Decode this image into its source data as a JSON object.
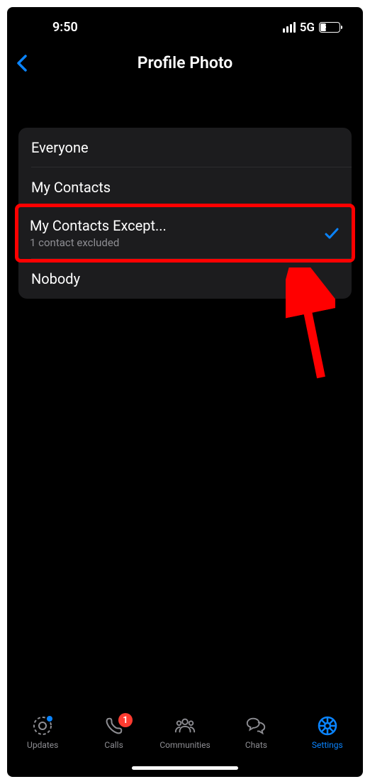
{
  "statusBar": {
    "time": "9:50",
    "network": "5G",
    "battery": "32"
  },
  "header": {
    "title": "Profile Photo"
  },
  "options": {
    "0": {
      "label": "Everyone"
    },
    "1": {
      "label": "My Contacts"
    },
    "2": {
      "label": "My Contacts Except...",
      "subtitle": "1 contact excluded"
    },
    "3": {
      "label": "Nobody"
    }
  },
  "tabs": {
    "updates": {
      "label": "Updates"
    },
    "calls": {
      "label": "Calls",
      "badge": "1"
    },
    "communities": {
      "label": "Communities"
    },
    "chats": {
      "label": "Chats"
    },
    "settings": {
      "label": "Settings"
    }
  }
}
